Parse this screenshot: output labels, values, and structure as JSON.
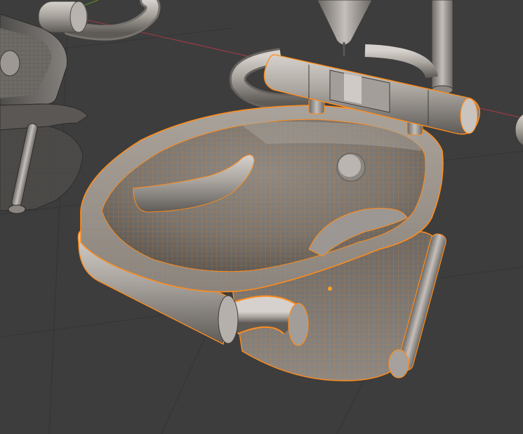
{
  "viewport": {
    "background": "#3d3d3d",
    "grid_color": "#343434",
    "x_axis_color": "#9a3b45",
    "y_axis_color": "#5a8a2a",
    "selection_outline_color": "#ff8c1a",
    "object_origin_color": "#ffa020"
  },
  "objects": {
    "selected_basin": {
      "selected": true,
      "parts": [
        "basin-rim",
        "basin-bowl",
        "faucet-bar",
        "drain",
        "soap-dish",
        "lower-hose",
        "bracket"
      ]
    },
    "left_basin": {
      "selected": false
    },
    "background_stand": {
      "selected": false
    }
  }
}
